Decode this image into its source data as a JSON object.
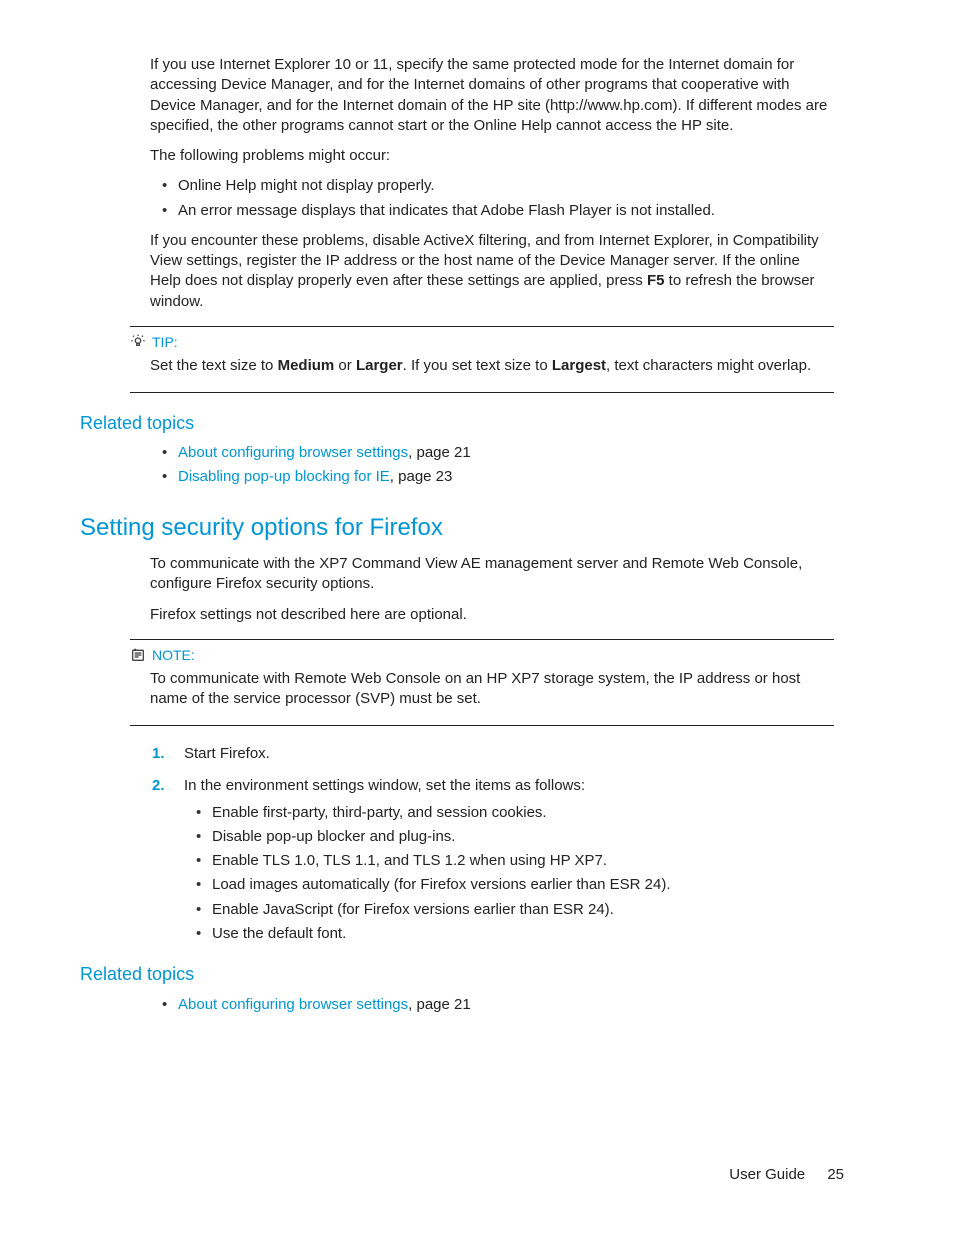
{
  "intro": {
    "p1": "If you use Internet Explorer 10 or 11, specify the same protected mode for the Internet domain for accessing Device Manager, and for the Internet domains of other programs that cooperative with Device Manager, and for the Internet domain of the HP site (http://www.hp.com). If different modes are specified, the other programs cannot start or the Online Help cannot access the HP site.",
    "p2": "The following problems might occur:",
    "problems": [
      "Online Help might not display properly.",
      "An error message displays that indicates that Adobe Flash Player is not installed."
    ],
    "p3_a": "If you encounter these problems, disable ActiveX filtering, and from Internet Explorer, in Compatibility View settings, register the IP address or the host name of the Device Manager server. If the online Help does not display properly even after these settings are applied, press ",
    "p3_b": "F5",
    "p3_c": " to refresh the browser window."
  },
  "tip": {
    "label": "TIP:",
    "t1": "Set the text size to ",
    "t2": "Medium",
    "t3": " or ",
    "t4": "Larger",
    "t5": ". If you set text size to ",
    "t6": "Largest",
    "t7": ", text characters might overlap."
  },
  "related1": {
    "heading": "Related topics",
    "items": [
      {
        "link": "About configuring browser settings",
        "suffix": ", page 21"
      },
      {
        "link": "Disabling pop-up blocking for IE",
        "suffix": ", page 23"
      }
    ]
  },
  "section2": {
    "heading": "Setting security options for Firefox",
    "p1": "To communicate with the XP7 Command View AE management server and Remote Web Console, configure Firefox security options.",
    "p2": "Firefox settings not described here are optional."
  },
  "note": {
    "label": "NOTE:",
    "body": "To communicate with Remote Web Console on an HP XP7 storage system, the IP address or host name of the service processor (SVP) must be set."
  },
  "steps": {
    "s1": "Start Firefox.",
    "s2": "In the environment settings window, set the items as follows:",
    "s2_sub": [
      "Enable first-party, third-party, and session cookies.",
      "Disable pop-up blocker and plug-ins.",
      "Enable TLS 1.0, TLS 1.1, and TLS 1.2 when using HP XP7.",
      "Load images automatically (for Firefox versions earlier than ESR 24).",
      "Enable JavaScript (for Firefox versions earlier than ESR 24).",
      "Use the default font."
    ]
  },
  "related2": {
    "heading": "Related topics",
    "items": [
      {
        "link": "About configuring browser settings",
        "suffix": ", page 21"
      }
    ]
  },
  "footer": {
    "label": "User Guide",
    "page": "25"
  }
}
